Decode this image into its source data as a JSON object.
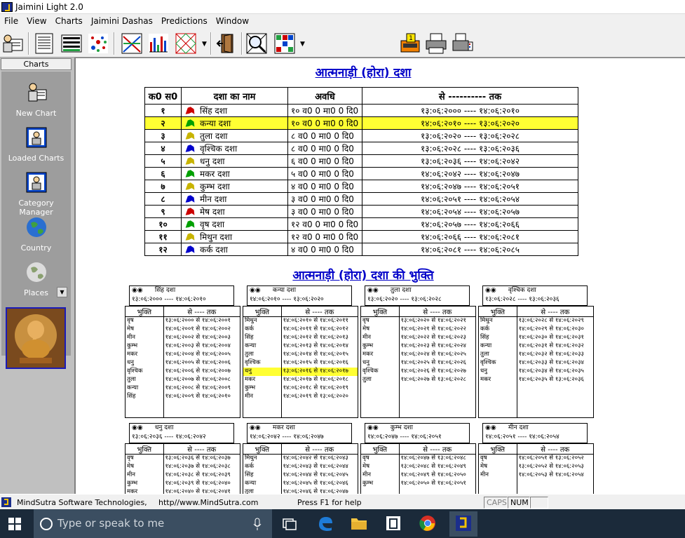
{
  "app": {
    "title": "Jaimini Light 2.0"
  },
  "menu": [
    "File",
    "View",
    "Charts",
    "Jaimini Dashas",
    "Predictions",
    "Window"
  ],
  "toolbar_icons": [
    "open-person-icon",
    "text-report-icon",
    "grid-table-icon",
    "star-field-icon",
    "cross-arrows-icon",
    "bar-graph-icon",
    "diamond-chart-icon",
    "exit-door-icon",
    "magnify-chart-icon",
    "colored-grid-icon",
    "calculator-icon",
    "printer-icon",
    "fax-printer-icon"
  ],
  "left_panel": {
    "header": "Charts",
    "items": [
      {
        "label": "New Chart",
        "icon": "new-chart-icon"
      },
      {
        "label": "Loaded Charts",
        "icon": "loaded-charts-icon"
      },
      {
        "label": "Category Manager",
        "icon": "category-manager-icon"
      },
      {
        "label": "Country",
        "icon": "globe-icon"
      },
      {
        "label": "Places",
        "icon": "places-globe-icon"
      }
    ],
    "picture": "ganesha-image"
  },
  "main": {
    "title": "आत्मनाड़ी (होरा) दशा",
    "headers": [
      "क0 स0",
      "दशा का नाम",
      "अवधि",
      "से ---------- तक"
    ],
    "rows": [
      {
        "n": "१",
        "name": "सिंह दशा",
        "period": "१० व0 0 मा0 0 दि0",
        "range": "१३:०६:२००० ---- १४:०६:२०१०",
        "color": "#cc0000",
        "highlight": false
      },
      {
        "n": "२",
        "name": "कन्या दशा",
        "period": "१० व0 0 मा0 0 दि0",
        "range": "१४:०६:२०१० ---- १३:०६:२०२०",
        "color": "#00a000",
        "highlight": true
      },
      {
        "n": "३",
        "name": "तुला दशा",
        "period": "८ व0 0 मा0 0 दि0",
        "range": "१३:०६:२०२० ---- १३:०६:२०२८",
        "color": "#c8b400",
        "highlight": false
      },
      {
        "n": "४",
        "name": "वृश्चिक दशा",
        "period": "८ व0 0 मा0 0 दि0",
        "range": "१३:०६:२०२८ ---- १३:०६:२०३६",
        "color": "#0000cc",
        "highlight": false
      },
      {
        "n": "५",
        "name": "धनु दशा",
        "period": "६ व0 0 मा0 0 दि0",
        "range": "१३:०६:२०३६ ---- १४:०६:२०४२",
        "color": "#c8b400",
        "highlight": false
      },
      {
        "n": "६",
        "name": "मकर दशा",
        "period": "५ व0 0 मा0 0 दि0",
        "range": "१४:०६:२०४२ ---- १४:०६:२०४७",
        "color": "#00a000",
        "highlight": false
      },
      {
        "n": "७",
        "name": "कुम्भ दशा",
        "period": "४ व0 0 मा0 0 दि0",
        "range": "१४:०६:२०४७ ---- १४:०६:२०५१",
        "color": "#c8b400",
        "highlight": false
      },
      {
        "n": "८",
        "name": "मीन दशा",
        "period": "३ व0 0 मा0 0 दि0",
        "range": "१४:०६:२०५१ ---- १४:०६:२०५४",
        "color": "#0000cc",
        "highlight": false
      },
      {
        "n": "९",
        "name": "मेष दशा",
        "period": "३ व0 0 मा0 0 दि0",
        "range": "१४:०६:२०५४ ---- १४:०६:२०५७",
        "color": "#cc0000",
        "highlight": false
      },
      {
        "n": "१०",
        "name": "वृष दशा",
        "period": "१२ व0 0 मा0 0 दि0",
        "range": "१४:०६:२०५७ ---- १४:०६:२०६६",
        "color": "#00a000",
        "highlight": false
      },
      {
        "n": "११",
        "name": "मिथुन दशा",
        "period": "१२ व0 0 मा0 0 दि0",
        "range": "१४:०६:२०६६ ---- १४:०६:२०८१",
        "color": "#c8b400",
        "highlight": false
      },
      {
        "n": "१२",
        "name": "कर्क दशा",
        "period": "४ व0 0 मा0 0 दि0",
        "range": "१४:०६:२०८१ ---- १४:०६:२०८५",
        "color": "#0000cc",
        "highlight": false
      }
    ]
  },
  "bhukti": {
    "title": "आत्मनाड़ी (होरा) दशा की भुक्ति",
    "col_headers": [
      "भुक्ति",
      "से ---- तक"
    ],
    "blocks": [
      {
        "name": "सिंह दशा",
        "range": "१३:०६:२००० ---- १४:०६:२०१०",
        "rows": [
          [
            "वृष",
            "१३:०६:२००० से १४:०६:२००१"
          ],
          [
            "मेष",
            "१४:०६:२००१ से १४:०६:२००२"
          ],
          [
            "मीन",
            "१४:०६:२००२ से १४:०६:२००३"
          ],
          [
            "कुम्भ",
            "१४:०६:२००३ से १४:०६:२००४"
          ],
          [
            "मकर",
            "१४:०६:२००४ से १४:०६:२००५"
          ],
          [
            "धनु",
            "१४:०६:२००५ से १४:०६:२००६"
          ],
          [
            "वृश्चिक",
            "१४:०६:२००६ से १४:०६:२००७"
          ],
          [
            "तुला",
            "१४:०६:२००७ से १४:०६:२००८"
          ],
          [
            "कन्या",
            "१४:०६:२००८ से १४:०६:२००९"
          ],
          [
            "सिंह",
            "१४:०६:२००९ से १४:०६:२०१०"
          ],
          [
            "",
            ""
          ],
          [
            "",
            ""
          ]
        ],
        "hl": -1
      },
      {
        "name": "कन्या दशा",
        "range": "१४:०६:२०१० ---- १३:०६:२०२०",
        "rows": [
          [
            "मिथुन",
            "१४:०६:२०१० से १४:०६:२०११"
          ],
          [
            "कर्क",
            "१४:०६:२०११ से १४:०६:२०१२"
          ],
          [
            "सिंह",
            "१४:०६:२०१२ से १४:०६:२०१३"
          ],
          [
            "कन्या",
            "१४:०६:२०१३ से १४:०६:२०१४"
          ],
          [
            "तुला",
            "१४:०६:२०१४ से १४:०६:२०१५"
          ],
          [
            "वृश्चिक",
            "१४:०६:२०१५ से १४:०६:२०१६"
          ],
          [
            "धनु",
            "१३:०६:२०१६ से १४:०६:२०१७"
          ],
          [
            "मकर",
            "१४:०६:२०१७ से १४:०६:२०१८"
          ],
          [
            "कुम्भ",
            "१४:०६:२०१८ से १४:०६:२०१९"
          ],
          [
            "मीन",
            "१४:०६:२०१९ से १३:०६:२०२०"
          ],
          [
            "",
            ""
          ],
          [
            "",
            ""
          ]
        ],
        "hl": 6
      },
      {
        "name": "तुला दशा",
        "range": "१३:०६:२०२० ---- १३:०६:२०२८",
        "rows": [
          [
            "वृष",
            "१३:०६:२०२० से १४:०६:२०२१"
          ],
          [
            "मेष",
            "१४:०६:२०२१ से १४:०६:२०२२"
          ],
          [
            "मीन",
            "१४:०६:२०२२ से १४:०६:२०२३"
          ],
          [
            "कुम्भ",
            "१४:०६:२०२३ से १४:०६:२०२४"
          ],
          [
            "मकर",
            "१४:०६:२०२४ से १४:०६:२०२५"
          ],
          [
            "धनु",
            "१४:०६:२०२५ से १४:०६:२०२६"
          ],
          [
            "वृश्चिक",
            "१४:०६:२०२६ से १४:०६:२०२७"
          ],
          [
            "तुला",
            "१४:०६:२०२७ से १३:०६:२०२८"
          ],
          [
            "",
            ""
          ],
          [
            "",
            ""
          ],
          [
            "",
            ""
          ],
          [
            "",
            ""
          ]
        ],
        "hl": -1
      },
      {
        "name": "वृश्चिक दशा",
        "range": "१३:०६:२०२८ ---- १३:०६:२०३६",
        "rows": [
          [
            "मिथुन",
            "१३:०६:२०२८ से १४:०६:२०२९"
          ],
          [
            "कर्क",
            "१४:०६:२०२९ से १४:०६:२०३०"
          ],
          [
            "सिंह",
            "१४:०६:२०३० से १४:०६:२०३१"
          ],
          [
            "कन्या",
            "१४:०६:२०३१ से १४:०६:२०३२"
          ],
          [
            "तुला",
            "१४:०६:२०३२ से १४:०६:२०३३"
          ],
          [
            "वृश्चिक",
            "१४:०६:२०३३ से १४:०६:२०३४"
          ],
          [
            "धनु",
            "१४:०६:२०३४ से १४:०६:२०३५"
          ],
          [
            "मकर",
            "१४:०६:२०३५ से १३:०६:२०३६"
          ],
          [
            "",
            ""
          ],
          [
            "",
            ""
          ],
          [
            "",
            ""
          ],
          [
            "",
            ""
          ]
        ],
        "hl": -1
      },
      {
        "name": "धनु दशा",
        "range": "१३:०६:२०३६ ---- १४:०६:२०४२",
        "rows": [
          [
            "वृष",
            "१३:०६:२०३६ से १४:०६:२०३७"
          ],
          [
            "मेष",
            "१४:०६:२०३७ से १४:०६:२०३८"
          ],
          [
            "मीन",
            "१४:०६:२०३८ से १४:०६:२०३९"
          ],
          [
            "कुम्भ",
            "१४:०६:२०३९ से १४:०६:२०४०"
          ],
          [
            "मकर",
            "१४:०६:२०४० से १४:०६:२०४१"
          ]
        ],
        "hl": -1
      },
      {
        "name": "मकर दशा",
        "range": "१४:०६:२०४२ ---- १४:०६:२०४७",
        "rows": [
          [
            "मिथुन",
            "१४:०६:२०४२ से १४:०६:२०४३"
          ],
          [
            "कर्क",
            "१४:०६:२०४३ से १४:०६:२०४४"
          ],
          [
            "सिंह",
            "१४:०६:२०४४ से १४:०६:२०४५"
          ],
          [
            "कन्या",
            "१४:०६:२०४५ से १४:०६:२०४६"
          ],
          [
            "तुला",
            "१४:०६:२०४६ से १४:०६:२०४७"
          ]
        ],
        "hl": -1
      },
      {
        "name": "कुम्भ दशा",
        "range": "१४:०६:२०४७ ---- १४:०६:२०५१",
        "rows": [
          [
            "वृष",
            "१४:०६:२०४७ से १३:०६:२०४८"
          ],
          [
            "मेष",
            "१३:०६:२०४८ से १४:०६:२०४९"
          ],
          [
            "मीन",
            "१४:०६:२०४९ से १४:०६:२०५०"
          ],
          [
            "कुम्भ",
            "१४:०६:२०५० से १४:०६:२०५१"
          ],
          [
            "",
            ""
          ]
        ],
        "hl": -1
      },
      {
        "name": "मीन दशा",
        "range": "१४:०६:२०५१ ---- १४:०६:२०५४",
        "rows": [
          [
            "वृष",
            "१४:०६:२०५१ से १३:०६:२०५२"
          ],
          [
            "मेष",
            "१३:०६:२०५२ से १४:०६:२०५३"
          ],
          [
            "मीन",
            "१४:०६:२०५३ से १४:०६:२०५४"
          ],
          [
            "",
            ""
          ],
          [
            "",
            ""
          ]
        ],
        "hl": -1
      }
    ]
  },
  "status": {
    "company": "MindSutra Software Technologies,",
    "url": "http//www.MindSutra.com",
    "help": "Press F1 for help",
    "caps": "CAPS",
    "num": "NUM"
  },
  "taskbar": {
    "search_placeholder": "Type or speak to me",
    "apps": [
      "task-view-icon",
      "edge-icon",
      "file-explorer-icon",
      "store-icon",
      "chrome-icon",
      "jaimini-app-icon"
    ]
  }
}
